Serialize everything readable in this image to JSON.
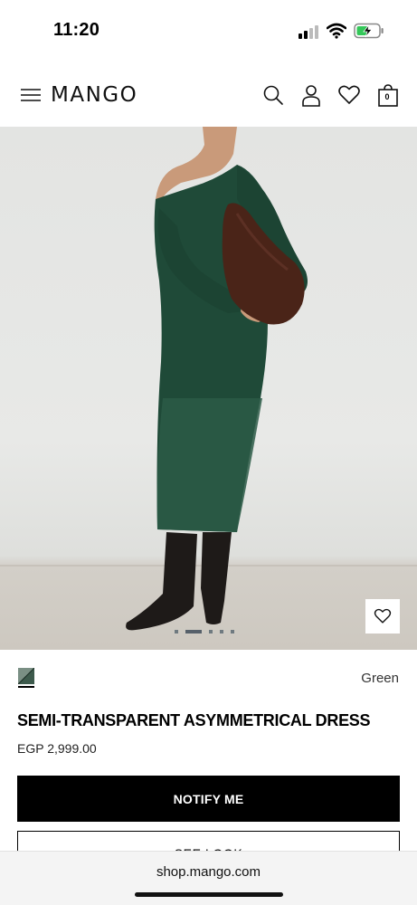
{
  "status_bar": {
    "time": "11:20"
  },
  "header": {
    "logo": "MANGO",
    "bag_count": "0",
    "icons": [
      "menu-icon",
      "search-icon",
      "user-icon",
      "heart-icon",
      "shopping-bag-icon"
    ]
  },
  "gallery": {
    "image_count": 5,
    "active_index": 1
  },
  "product": {
    "color_name": "Green",
    "title": "SEMI-TRANSPARENT ASYMMETRICAL DRESS",
    "price": "EGP 2,999.00",
    "notify_label": "NOTIFY ME",
    "secondary_label": "SEE LOOK"
  },
  "browser": {
    "url": "shop.mango.com"
  },
  "colors": {
    "dress_green": "#1f4a38",
    "button_black": "#000000",
    "background": "#ffffff"
  }
}
